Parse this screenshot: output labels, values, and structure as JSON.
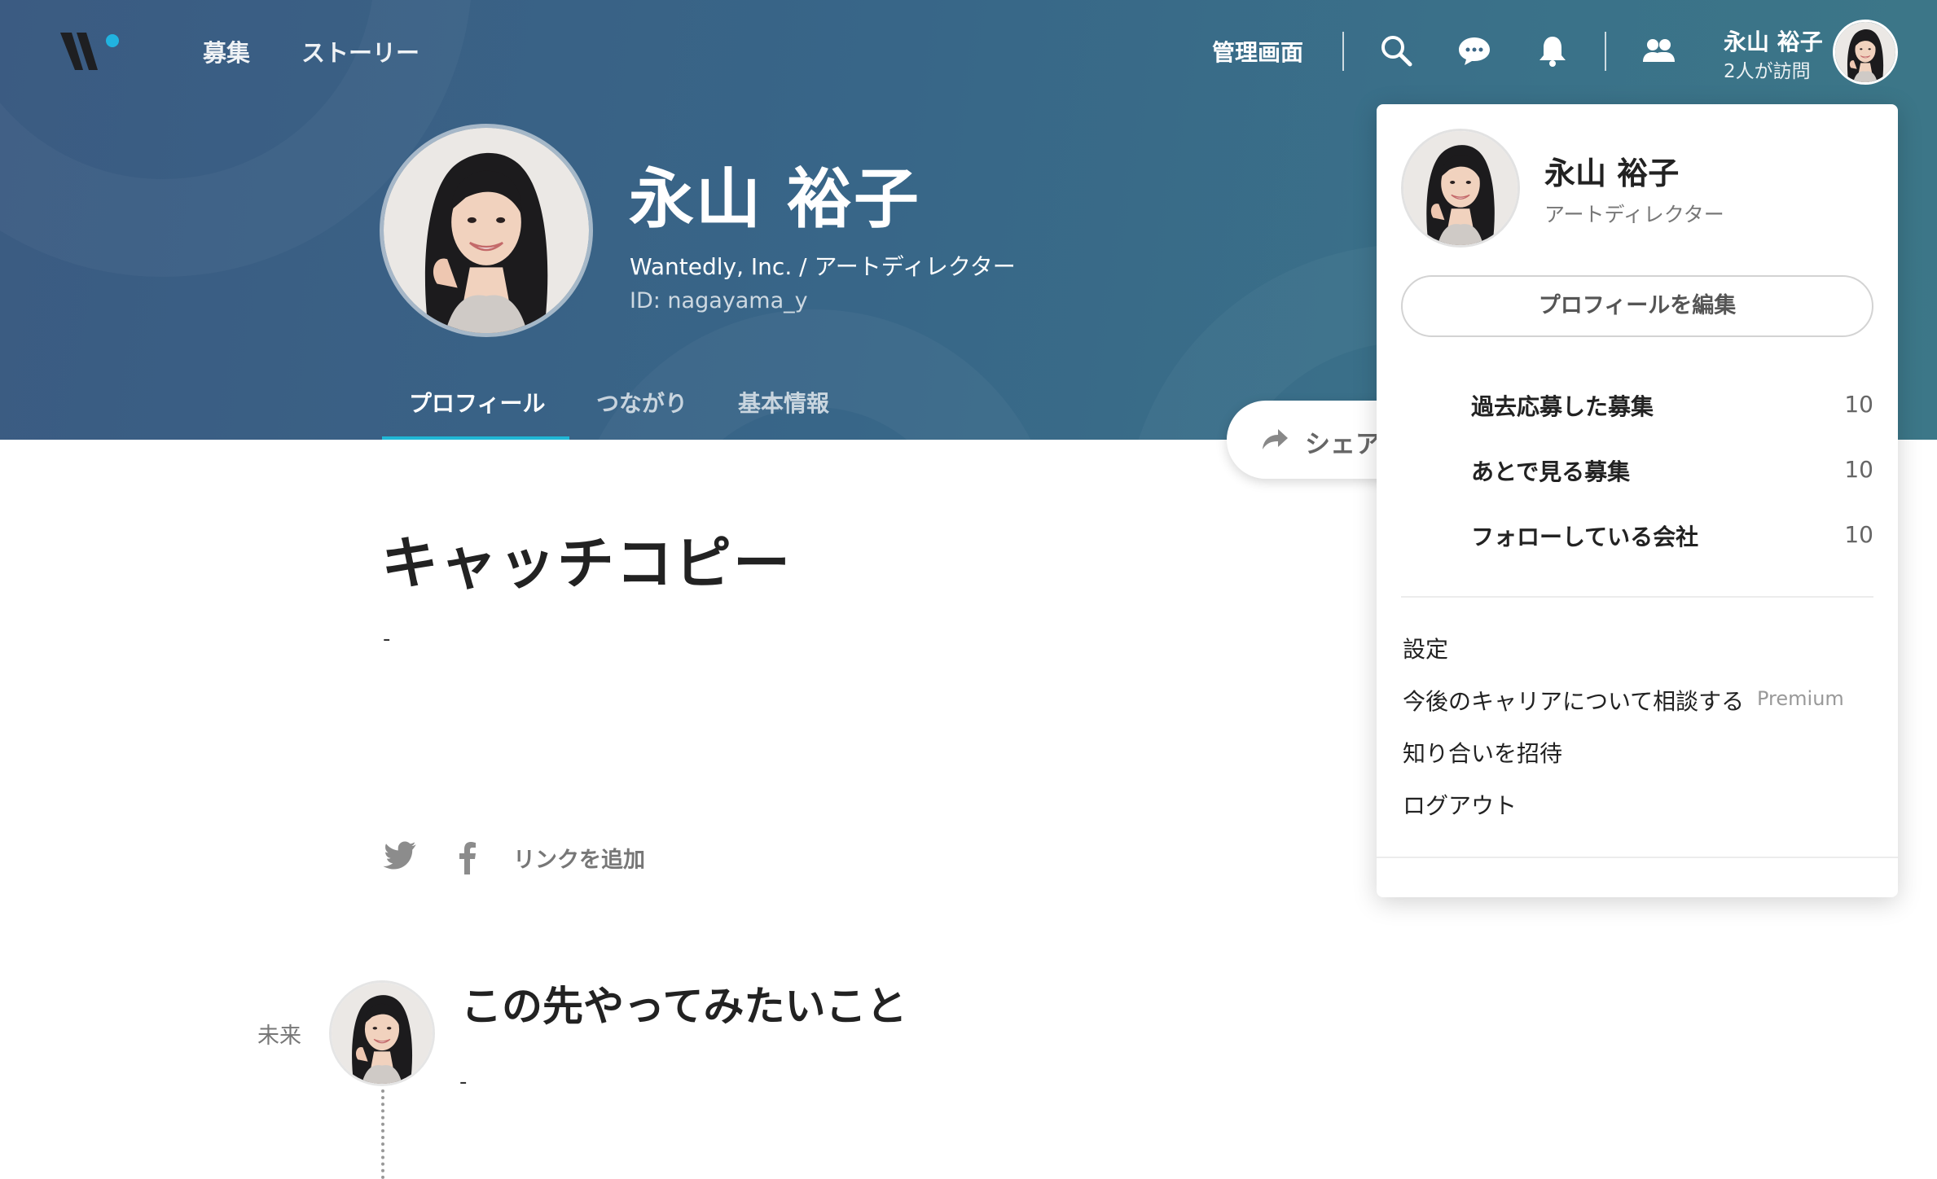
{
  "header": {
    "nav": {
      "recruit": "募集",
      "stories": "ストーリー"
    },
    "admin_label": "管理画面",
    "user": {
      "name": "永山 裕子",
      "visitors": "2人が訪問"
    },
    "icons": [
      "search-icon",
      "chat-icon",
      "bell-icon",
      "people-icon"
    ]
  },
  "profile": {
    "name": "永山 裕子",
    "title": "Wantedly, Inc. / アートディレクター",
    "id": "ID: nagayama_y",
    "tabs": [
      {
        "label": "プロフィール",
        "active": true
      },
      {
        "label": "つながり",
        "active": false
      },
      {
        "label": "基本情報",
        "active": false
      }
    ],
    "share_label": "シェア"
  },
  "main": {
    "catchcopy_title": "キャッチコピー",
    "catchcopy_value": "-",
    "social_icons": [
      "twitter-icon",
      "facebook-icon"
    ],
    "add_link_label": "リンクを追加",
    "future": {
      "label": "未来",
      "title": "この先やってみたいこと",
      "value": "-"
    }
  },
  "dropdown": {
    "name": "永山 裕子",
    "role": "アートディレクター",
    "edit_label": "プロフィールを編集",
    "stats": [
      {
        "label": "過去応募した募集",
        "count": "10"
      },
      {
        "label": "あとで見る募集",
        "count": "10"
      },
      {
        "label": "フォローしている会社",
        "count": "10"
      }
    ],
    "menu": {
      "settings": "設定",
      "career": "今後のキャリアについて相談する",
      "premium": "Premium",
      "invite": "知り合いを招待",
      "logout": "ログアウト"
    }
  },
  "colors": {
    "header_start": "#3b5b82",
    "header_end": "#3c7788",
    "tab_indicator": "#20b7d6",
    "logo_dot": "#21b3e0"
  }
}
